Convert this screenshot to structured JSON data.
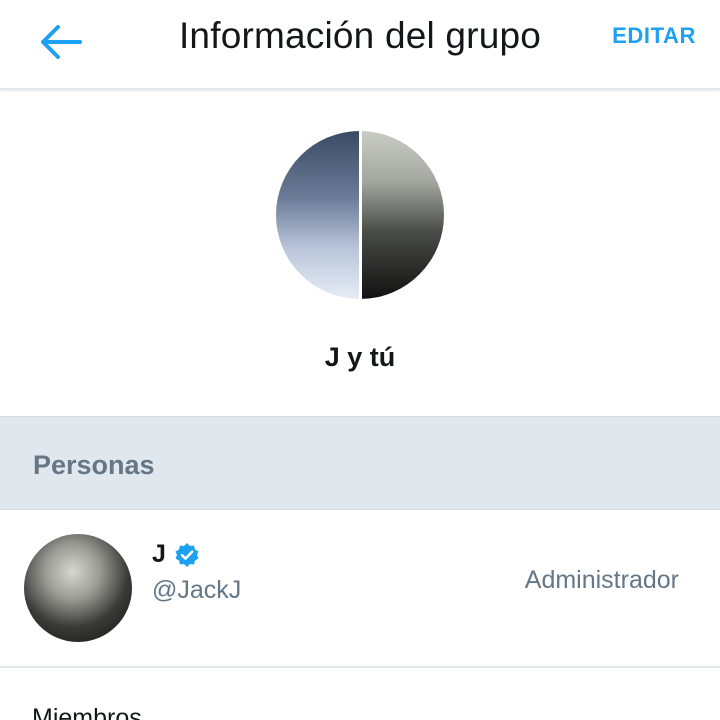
{
  "header": {
    "title": "Información del grupo",
    "edit_label": "EDITAR",
    "back_icon": "arrow-left-icon",
    "accent_color": "#1da1f2"
  },
  "group": {
    "name": "J y tú"
  },
  "people_section": {
    "title": "Personas",
    "members": [
      {
        "name": "J",
        "verified": true,
        "verified_icon": "verified-badge-icon",
        "handle": "@JackJ",
        "role": "Administrador"
      }
    ]
  },
  "members_section": {
    "title": "Miembros"
  }
}
